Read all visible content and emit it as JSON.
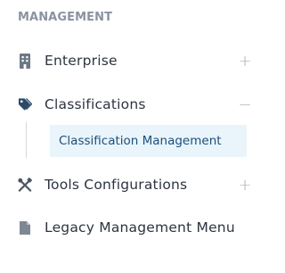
{
  "sidebar": {
    "section_title": "MANAGEMENT",
    "items": [
      {
        "label": "Enterprise",
        "icon": "building-icon",
        "toggle": "+"
      },
      {
        "label": "Classifications",
        "icon": "tag-icon",
        "toggle": "−",
        "children": [
          {
            "label": "Classification Management"
          }
        ]
      },
      {
        "label": "Tools Configurations",
        "icon": "tools-icon",
        "toggle": "+"
      },
      {
        "label": "Legacy Management Menu",
        "icon": "document-icon"
      }
    ]
  },
  "colors": {
    "accent_text": "#1c4f7a",
    "active_bg": "#e9f4fb",
    "icon": "#6c7884"
  }
}
